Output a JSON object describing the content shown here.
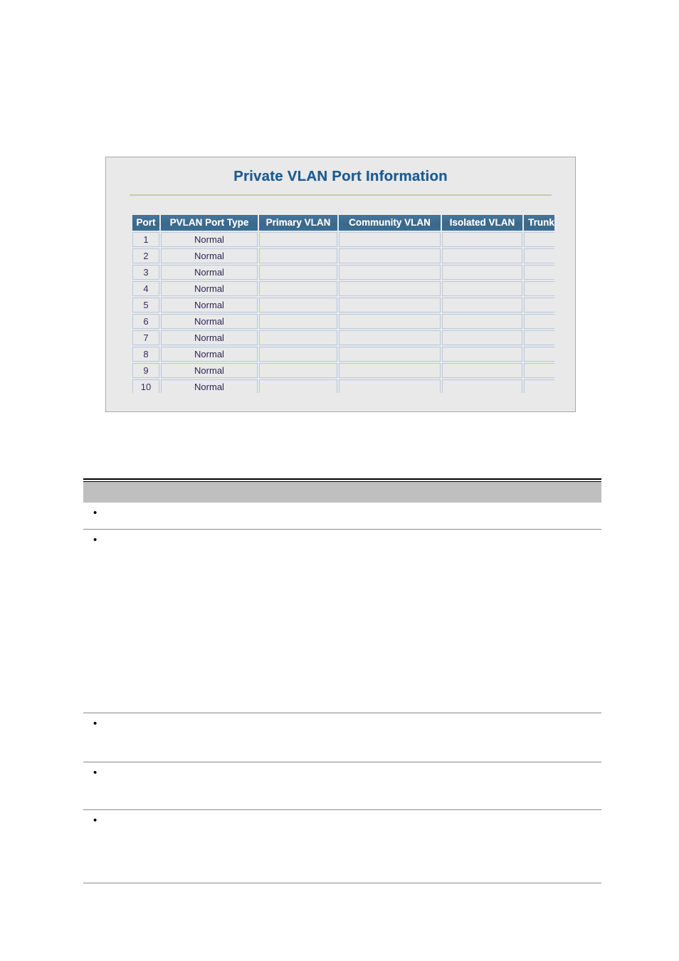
{
  "document": {
    "page_background": "#ffffff",
    "accent_title_color": "#1d5c8f",
    "header_band_color": "#bfbfbf",
    "table_header_color": "#3b6d90"
  },
  "screenshot_panel": {
    "title": "Private VLAN Port Information",
    "panel_background": "#e9e9e9",
    "divider_color": "#cdc8a8",
    "table": {
      "columns": [
        "Port",
        "PVLAN Port Type",
        "Primary VLAN",
        "Community VLAN",
        "Isolated VLAN",
        "Trunk"
      ],
      "rows": [
        {
          "port": "1",
          "pvlan_port_type": "Normal",
          "primary_vlan": "",
          "community_vlan": "",
          "isolated_vlan": "",
          "trunk": ""
        },
        {
          "port": "2",
          "pvlan_port_type": "Normal",
          "primary_vlan": "",
          "community_vlan": "",
          "isolated_vlan": "",
          "trunk": ""
        },
        {
          "port": "3",
          "pvlan_port_type": "Normal",
          "primary_vlan": "",
          "community_vlan": "",
          "isolated_vlan": "",
          "trunk": ""
        },
        {
          "port": "4",
          "pvlan_port_type": "Normal",
          "primary_vlan": "",
          "community_vlan": "",
          "isolated_vlan": "",
          "trunk": ""
        },
        {
          "port": "5",
          "pvlan_port_type": "Normal",
          "primary_vlan": "",
          "community_vlan": "",
          "isolated_vlan": "",
          "trunk": ""
        },
        {
          "port": "6",
          "pvlan_port_type": "Normal",
          "primary_vlan": "",
          "community_vlan": "",
          "isolated_vlan": "",
          "trunk": ""
        },
        {
          "port": "7",
          "pvlan_port_type": "Normal",
          "primary_vlan": "",
          "community_vlan": "",
          "isolated_vlan": "",
          "trunk": ""
        },
        {
          "port": "8",
          "pvlan_port_type": "Normal",
          "primary_vlan": "",
          "community_vlan": "",
          "isolated_vlan": "",
          "trunk": ""
        },
        {
          "port": "9",
          "pvlan_port_type": "Normal",
          "primary_vlan": "",
          "community_vlan": "",
          "isolated_vlan": "",
          "trunk": ""
        },
        {
          "port": "10",
          "pvlan_port_type": "Normal",
          "primary_vlan": "",
          "community_vlan": "",
          "isolated_vlan": "",
          "trunk": ""
        },
        {
          "port": "",
          "pvlan_port_type": "",
          "primary_vlan": "",
          "community_vlan": "",
          "isolated_vlan": "",
          "trunk": ""
        }
      ]
    }
  },
  "description_table": {
    "header_label": "",
    "bullet_rows": [
      {
        "text": ""
      },
      {
        "text": ""
      },
      {
        "text": ""
      },
      {
        "text": ""
      },
      {
        "text": ""
      }
    ]
  }
}
